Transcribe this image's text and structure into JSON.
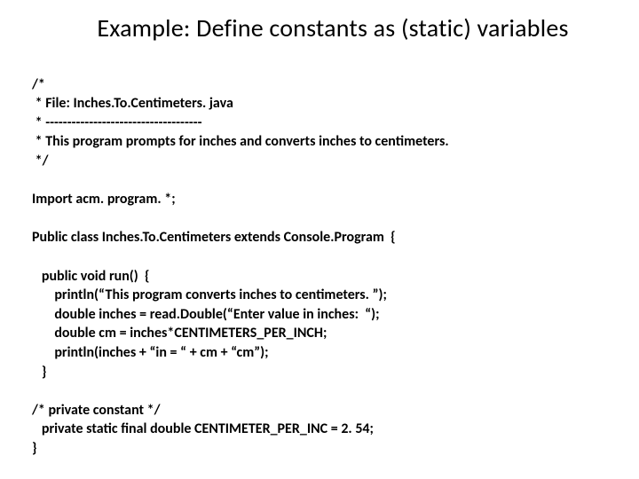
{
  "title": "Example: Define constants as (static) variables",
  "code": {
    "c1": "/*",
    "c2": " * File: Inches.To.Centimeters. java",
    "c3": " * ------------------------------------",
    "c4": " * This program prompts for inches and converts inches to centimeters.",
    "c5": " */",
    "c6": "",
    "c7": "Import acm. program. *;",
    "c8": "",
    "c9": "Public class Inches.To.Centimeters extends Console.Program  {",
    "c10": "",
    "c11": "   public void run()  {",
    "c12": "       println(“This program converts inches to centimeters. ”);",
    "c13": "       double inches = read.Double(“Enter value in inches:  “);",
    "c14": "       double cm = inches*CENTIMETERS_PER_INCH;",
    "c15": "       println(inches + “in = “ + cm + “cm”);",
    "c16": "   }",
    "c17": "",
    "c18": "/* private constant */",
    "c19": "   private static final double CENTIMETER_PER_INC = 2. 54;",
    "c20": "}"
  }
}
